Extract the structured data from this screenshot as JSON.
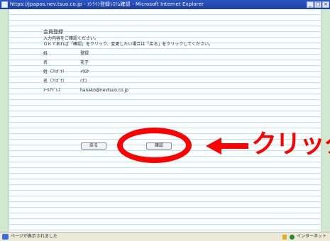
{
  "window": {
    "title": "https://jpapos.nev.tsuo.co.jp - ｵﾝﾗｲﾝ登録ｼｽﾃﾑ確認 - Microsoft Internet Explorer",
    "min_label": "_",
    "max_label": "□",
    "close_label": "×"
  },
  "page": {
    "heading": "会員登録",
    "instruction_1": "入力内容をご確認ください。",
    "instruction_2": "ＯＫであれば「確認」をクリック、変更したい場合は「戻る」をクリックしてください。",
    "fields": [
      {
        "label": "姓",
        "value": "登録"
      },
      {
        "label": "名",
        "value": "花子"
      },
      {
        "label": "姓（ﾌﾘｶﾞﾅ）",
        "value": "ﾄｳﾛｸ"
      },
      {
        "label": "名（ﾌﾘｶﾞﾅ）",
        "value": "ﾊﾅｺ"
      },
      {
        "label": "ﾒｰﾙｱﾄﾞﾚｽ",
        "value": "hanako@nevtsuo.co.jp"
      }
    ],
    "back_button": "戻る",
    "confirm_button": "確認"
  },
  "annotation": {
    "click_label": "クリック",
    "color": "#ff0000"
  },
  "statusbar": {
    "status_text": "ページが表示されました",
    "zone_text": "インターネット"
  }
}
